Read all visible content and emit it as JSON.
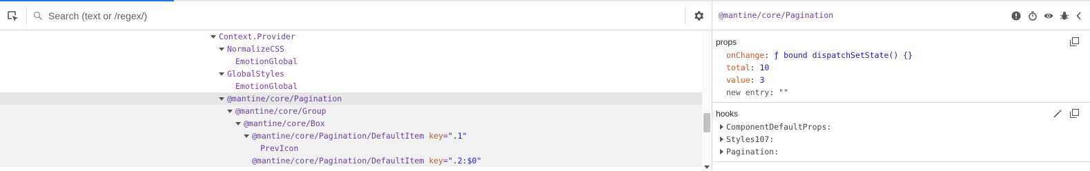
{
  "search": {
    "placeholder": "Search (text or /regex/)"
  },
  "tree": [
    {
      "name": "Context.Provider",
      "expanded": true
    },
    {
      "name": "NormalizeCSS",
      "expanded": true
    },
    {
      "name": "EmotionGlobal"
    },
    {
      "name": "GlobalStyles",
      "expanded": true
    },
    {
      "name": "EmotionGlobal"
    },
    {
      "name": "@mantine/core/Pagination",
      "expanded": true,
      "selected": true
    },
    {
      "name": "@mantine/core/Group",
      "expanded": true
    },
    {
      "name": "@mantine/core/Box",
      "expanded": true
    },
    {
      "name": "@mantine/core/Pagination/DefaultItem",
      "expanded": true,
      "key_label": "key",
      "key_value": "\".1\""
    },
    {
      "name": "PrevIcon"
    },
    {
      "name": "@mantine/core/Pagination/DefaultItem",
      "key_label": "key",
      "key_value": "\".2:$0\""
    }
  ],
  "inspector": {
    "title": "@mantine/core/Pagination",
    "props_title": "props",
    "props": [
      {
        "key": "onChange",
        "value": "ƒ bound dispatchSetState() {}"
      },
      {
        "key": "total",
        "value": "10"
      },
      {
        "key": "value",
        "value": "3"
      },
      {
        "key": "new entry",
        "value": "\"\""
      }
    ],
    "hooks_title": "hooks",
    "hooks": [
      {
        "name": "ComponentDefaultProps:"
      },
      {
        "name": "Styles107:"
      },
      {
        "name": "Pagination:"
      }
    ]
  },
  "icons": {
    "inspect": "inspect-element-icon",
    "search": "search-icon",
    "settings": "gear-icon",
    "suspend": "warning-icon",
    "timer": "stopwatch-icon",
    "eye": "eye-icon",
    "bug": "bug-icon",
    "source": "code-icon",
    "copy": "copy-icon",
    "wand": "magic-wand-icon"
  },
  "colors": {
    "accent": "#1a73e8",
    "component": "#6b3fa3",
    "key": "#c85a2b",
    "value": "#1a1aa6"
  }
}
